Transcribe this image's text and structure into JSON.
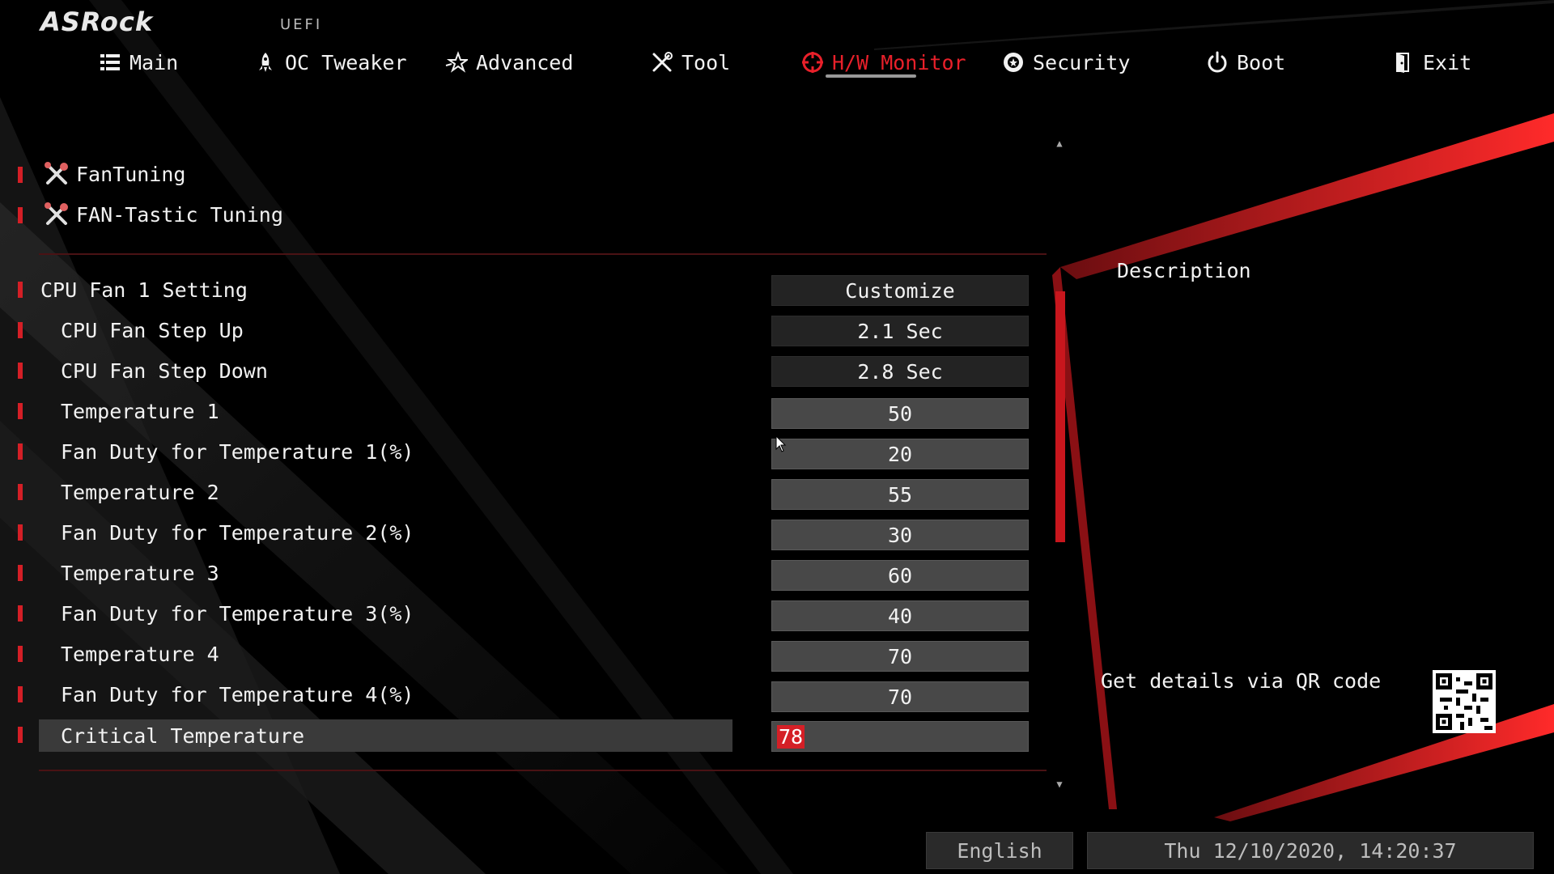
{
  "brand": {
    "logo": "ASRock",
    "firmware": "UEFI"
  },
  "nav": {
    "tabs": [
      {
        "label": "Main",
        "icon": "list-icon"
      },
      {
        "label": "OC Tweaker",
        "icon": "rocket-icon"
      },
      {
        "label": "Advanced",
        "icon": "star-icon"
      },
      {
        "label": "Tool",
        "icon": "tools-icon"
      },
      {
        "label": "H/W Monitor",
        "icon": "target-icon",
        "active": true
      },
      {
        "label": "Security",
        "icon": "shield-icon"
      },
      {
        "label": "Boot",
        "icon": "power-icon"
      },
      {
        "label": "Exit",
        "icon": "exit-door-icon"
      }
    ]
  },
  "submenus": [
    {
      "label": "FanTuning",
      "icon": "wrench-cross-icon"
    },
    {
      "label": "FAN-Tastic Tuning",
      "icon": "wrench-cross-icon"
    }
  ],
  "settings": [
    {
      "label": "CPU Fan 1 Setting",
      "value": "Customize",
      "style": "dark",
      "indent": false
    },
    {
      "label": "CPU Fan Step Up",
      "value": "2.1 Sec",
      "style": "dark",
      "indent": true
    },
    {
      "label": "CPU Fan Step Down",
      "value": "2.8 Sec",
      "style": "dark",
      "indent": true
    },
    {
      "label": "Temperature 1",
      "value": "50",
      "style": "light",
      "indent": true
    },
    {
      "label": "Fan Duty for Temperature 1(%)",
      "value": "20",
      "style": "light",
      "indent": true
    },
    {
      "label": "Temperature 2",
      "value": "55",
      "style": "light",
      "indent": true
    },
    {
      "label": "Fan Duty for Temperature 2(%)",
      "value": "30",
      "style": "light",
      "indent": true
    },
    {
      "label": "Temperature 3",
      "value": "60",
      "style": "light",
      "indent": true
    },
    {
      "label": "Fan Duty for Temperature 3(%)",
      "value": "40",
      "style": "light",
      "indent": true
    },
    {
      "label": "Temperature 4",
      "value": "70",
      "style": "light",
      "indent": true
    },
    {
      "label": "Fan Duty for Temperature 4(%)",
      "value": "70",
      "style": "light",
      "indent": true
    },
    {
      "label": "Critical Temperature",
      "value": "78",
      "style": "light",
      "indent": true,
      "selected": true,
      "editing": true
    }
  ],
  "description": {
    "title": "Description",
    "qr_text": "Get details via QR code"
  },
  "footer": {
    "language": "English",
    "datetime": "Thu 12/10/2020, 14:20:37"
  },
  "colors": {
    "accent": "#d41f26",
    "background": "#000000",
    "value_dark": "#232323",
    "value_light": "#484848"
  }
}
